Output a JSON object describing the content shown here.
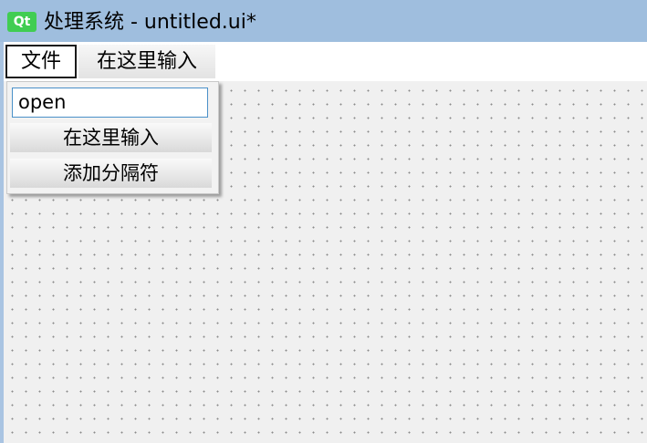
{
  "window": {
    "logo_text": "Qt",
    "title": "处理系统 - untitled.ui*"
  },
  "menubar": {
    "file_label": "文件",
    "type_here_label": "在这里输入"
  },
  "dropdown": {
    "input_value": "open",
    "items": [
      {
        "label": "在这里输入"
      },
      {
        "label": "添加分隔符"
      }
    ]
  },
  "colors": {
    "titlebar": "#9fbede",
    "qt_green": "#41cd52",
    "input_border": "#4a90c8",
    "canvas": "#f0f0f0"
  }
}
